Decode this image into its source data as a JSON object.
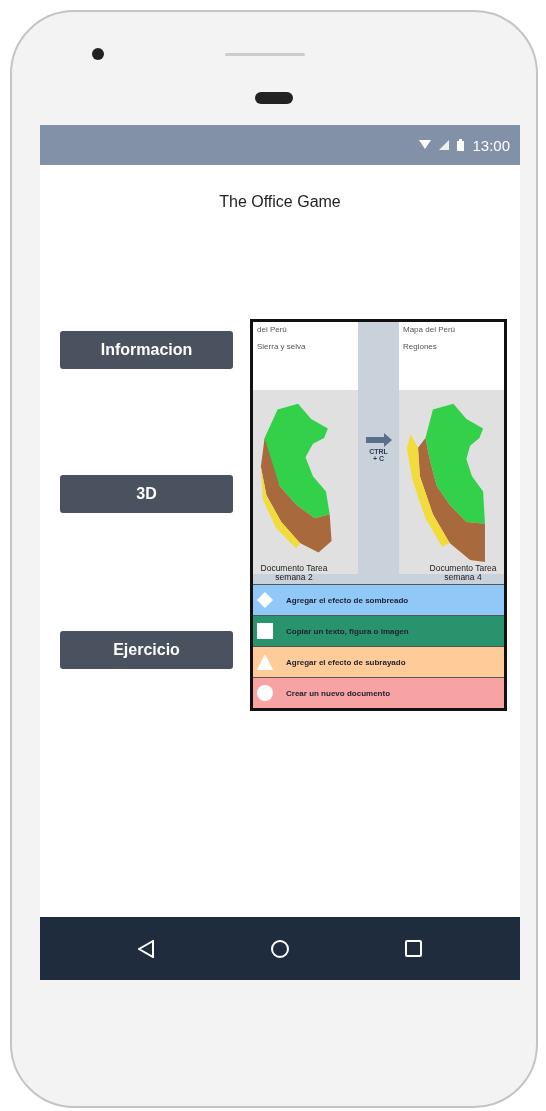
{
  "status_bar": {
    "time": "13:00"
  },
  "app": {
    "title": "The Office Game"
  },
  "buttons": [
    {
      "label": "Informacion"
    },
    {
      "label": "3D"
    },
    {
      "label": "Ejercicio"
    }
  ],
  "figure": {
    "documents": [
      {
        "heading": "del Perú",
        "subheading": "Sierra y selva",
        "caption": "Documento Tarea semana 2"
      },
      {
        "heading": "Mapa del Perú",
        "subheading": "Regiones",
        "caption": "Documento Tarea semana 4"
      }
    ],
    "arrow_label": "CTRL + C",
    "legend": [
      {
        "kind": "diamond",
        "color": "#90c8f8",
        "text": "Agregar el efecto de sombreado"
      },
      {
        "kind": "square",
        "color": "#28936c",
        "text": "Copiar un texto, figura o imagen"
      },
      {
        "kind": "triangle",
        "color": "#ffcc99",
        "text": "Agregar el efecto de subrayado"
      },
      {
        "kind": "circle",
        "color": "#f7a3a3",
        "text": "Crear un nuevo documento"
      }
    ]
  }
}
